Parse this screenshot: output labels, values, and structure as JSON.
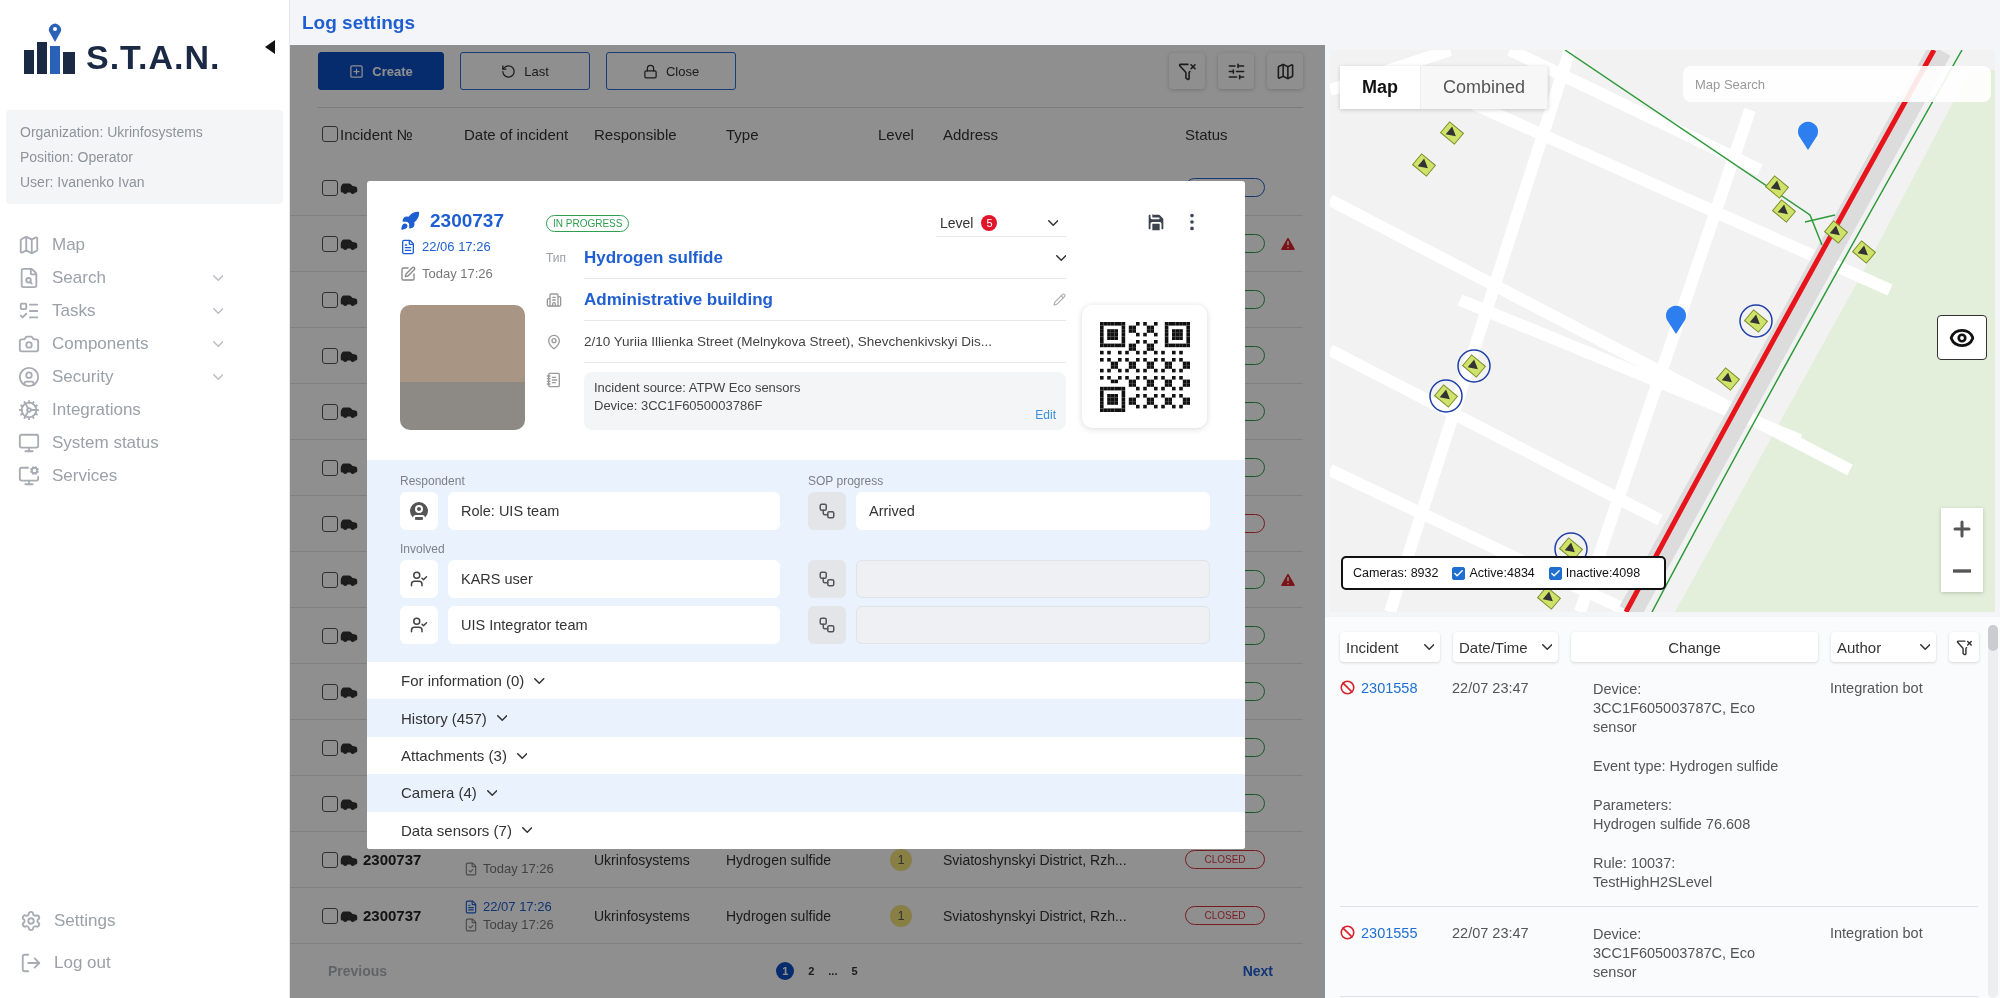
{
  "sidebar": {
    "logo": "S.T.A.N.",
    "info": [
      "Organization: Ukrinfosystems",
      "Position: Operator",
      "User: Ivanenko Ivan"
    ],
    "nav": [
      {
        "label": "Map",
        "expandable": false
      },
      {
        "label": "Search",
        "expandable": true
      },
      {
        "label": "Tasks",
        "expandable": true
      },
      {
        "label": "Components",
        "expandable": true
      },
      {
        "label": "Security",
        "expandable": true
      },
      {
        "label": "Integrations",
        "expandable": false
      },
      {
        "label": "System status",
        "expandable": false
      },
      {
        "label": "Services",
        "expandable": false
      }
    ],
    "bottom": [
      "Settings",
      "Log out"
    ]
  },
  "header": {
    "title": "Log settings"
  },
  "toolbar": {
    "buttons": [
      {
        "label": "Create",
        "kind": "primary"
      },
      {
        "label": "Last",
        "kind": "outline"
      },
      {
        "label": "Close",
        "kind": "outline"
      }
    ]
  },
  "table": {
    "columns": [
      "Incident №",
      "Date of incident",
      "Responsible",
      "Type",
      "Level",
      "Address",
      "Status"
    ],
    "select_all": {
      "checked": false
    },
    "rows": [
      {
        "kind": "covered",
        "checked": false,
        "color": "#17376f",
        "warning": false
      },
      {
        "kind": "covered",
        "checked": false,
        "color": "#1a592c",
        "warning": true
      },
      {
        "kind": "covered",
        "checked": false,
        "color": "#1a592c",
        "warning": false
      },
      {
        "kind": "covered",
        "checked": false,
        "color": "#1a592c",
        "warning": false
      },
      {
        "kind": "covered",
        "checked": false,
        "color": "#1a592c",
        "warning": false
      },
      {
        "kind": "covered",
        "checked": false,
        "color": "#1a592c",
        "warning": false
      },
      {
        "kind": "covered",
        "checked": false,
        "color": "#791c22",
        "warning": false
      },
      {
        "kind": "covered",
        "checked": false,
        "color": "#1a592c",
        "warning": true
      },
      {
        "kind": "covered",
        "checked": false,
        "color": "#1a592c",
        "warning": false
      },
      {
        "kind": "covered",
        "checked": false,
        "color": "#1a592c",
        "warning": false
      },
      {
        "kind": "covered",
        "checked": false,
        "color": "#1a592c",
        "warning": false
      },
      {
        "kind": "covered",
        "checked": false,
        "color": "#1a592c",
        "warning": false
      },
      {
        "kind": "full",
        "checked": false,
        "number": "2300737",
        "updated": "Today 17:26",
        "responsible": "Ukrinfosystems",
        "type": "Hydrogen sulfide",
        "level_label": "1",
        "address": "Sviatoshynskyi District, Rzh...",
        "status": "CLOSED",
        "color": "#791c22",
        "warning": false
      },
      {
        "kind": "full",
        "checked": false,
        "number": "2300737",
        "created": "22/07 17:26",
        "updated": "Today 17:26",
        "responsible": "Ukrinfosystems",
        "type": "Hydrogen sulfide",
        "level_label": "1",
        "address": "Sviatoshynskyi District, Rzh...",
        "status": "CLOSED",
        "color": "#791c22",
        "warning": false
      }
    ]
  },
  "pagination": {
    "previous": "Previous",
    "items": [
      {
        "kind": "page",
        "label": "1",
        "selected": true
      },
      {
        "kind": "page",
        "label": "2",
        "selected": false
      },
      {
        "kind": "gap",
        "label": "..."
      },
      {
        "kind": "page",
        "label": "5",
        "selected": false
      }
    ],
    "next": "Next"
  },
  "incident": {
    "number": "2300737",
    "status": "IN PROGRESS",
    "created": "22/06 17:26",
    "updated": "Today 17:26",
    "level_label": "Level",
    "level_value": "5",
    "type_label": "Тип",
    "type": "Hydrogen sulfide",
    "object": "Administrative building",
    "address": "2/10 Yuriia Illienka Street (Melnykova Street), Shevchenkivskyi Dis...",
    "note": [
      "Incident source: ATPW Eco sensors",
      "Device: 3CC1F6050003786F"
    ],
    "edit": "Edit",
    "respondent": {
      "label": "Respondent",
      "value": "Role: UIS team"
    },
    "sop": {
      "label": "SOP progress",
      "value": "Arrived"
    },
    "involved": {
      "label": "Involved",
      "items": [
        "KARS user",
        "UIS Integrator team"
      ]
    },
    "sections": [
      {
        "label": "For information (0)",
        "expanded": false
      },
      {
        "label": "History (457)",
        "expanded": false
      },
      {
        "label": "Attachments (3)",
        "expanded": false
      },
      {
        "label": "Camera (4)",
        "expanded": false
      },
      {
        "label": "Data sensors (7)",
        "expanded": false
      }
    ]
  },
  "map": {
    "tabs": [
      {
        "label": "Map",
        "selected": true
      },
      {
        "label": "Combined",
        "selected": false
      }
    ],
    "search": {
      "placeholder": "Map Search"
    },
    "legend": {
      "total": "Cameras: 8932",
      "filters": [
        {
          "label": "Active:4834",
          "checked": true
        },
        {
          "label": "Inactive:4098",
          "checked": true
        }
      ]
    }
  },
  "log": {
    "columns": [
      {
        "label": "Incident",
        "dropdown": true
      },
      {
        "label": "Date/Time",
        "dropdown": true
      },
      {
        "label": "Change",
        "dropdown": false
      },
      {
        "label": "Author",
        "dropdown": true
      }
    ],
    "rows": [
      {
        "incident": "2301558",
        "time": "22/07 23:47",
        "change": [
          "Device:\n3CC1F605003787C, Eco\nsensor",
          "Event type: Hydrogen sulfide",
          "Parameters:\nHydrogen sulfide 76.608",
          "Rule: 10037:\nTestHighH2SLevel"
        ],
        "author": "Integration bot"
      },
      {
        "incident": "2301555",
        "time": "22/07 23:47",
        "change": [
          "Device:\n3CC1F605003787C, Eco\nsensor"
        ],
        "author": "Integration bot"
      }
    ]
  }
}
